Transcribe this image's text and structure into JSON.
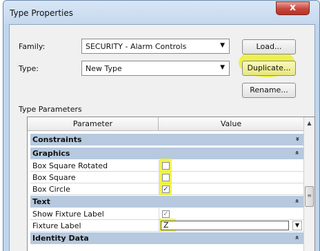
{
  "window": {
    "title": "Type Properties",
    "close_glyph": "x"
  },
  "family": {
    "label": "Family:",
    "value": "SECURITY - Alarm Controls"
  },
  "type": {
    "label": "Type:",
    "value": "New Type"
  },
  "buttons": {
    "load": "Load...",
    "duplicate": "Duplicate...",
    "rename": "Rename..."
  },
  "type_parameters": {
    "title": "Type Parameters",
    "columns": [
      "Parameter",
      "Value"
    ],
    "categories": {
      "constraints": "Constraints",
      "graphics": "Graphics",
      "text": "Text",
      "identity": "Identity Data"
    },
    "params": {
      "box_square_rotated": {
        "name": "Box Square Rotated",
        "checked": false
      },
      "box_square": {
        "name": "Box Square",
        "checked": false
      },
      "box_circle": {
        "name": "Box Circle",
        "checked": true
      },
      "show_fixture_label": {
        "name": "Show Fixture Label",
        "checked": true
      },
      "fixture_label": {
        "name": "Fixture Label",
        "value": "Z"
      }
    }
  },
  "glyphs": {
    "check": "✓",
    "dropdown": "▼",
    "collapse": "»",
    "expand": "»",
    "scroll_up": "▲",
    "grip": "≡"
  },
  "highlight_color": "#eef014"
}
